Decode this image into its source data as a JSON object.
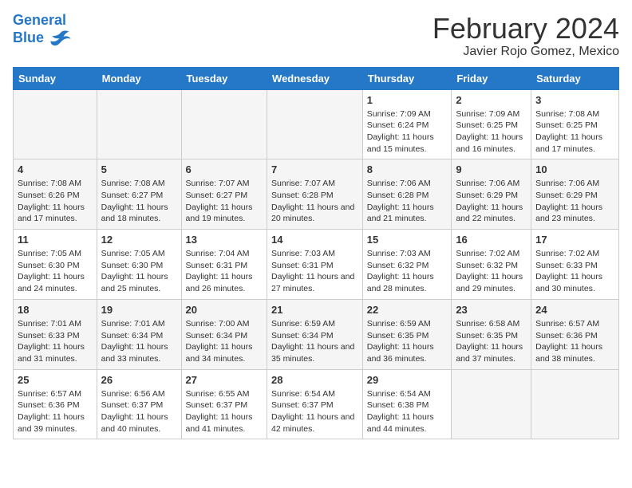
{
  "header": {
    "logo_line1": "General",
    "logo_line2": "Blue",
    "title": "February 2024",
    "subtitle": "Javier Rojo Gomez, Mexico"
  },
  "weekdays": [
    "Sunday",
    "Monday",
    "Tuesday",
    "Wednesday",
    "Thursday",
    "Friday",
    "Saturday"
  ],
  "weeks": [
    [
      {
        "day": "",
        "sunrise": "",
        "sunset": "",
        "daylight": ""
      },
      {
        "day": "",
        "sunrise": "",
        "sunset": "",
        "daylight": ""
      },
      {
        "day": "",
        "sunrise": "",
        "sunset": "",
        "daylight": ""
      },
      {
        "day": "",
        "sunrise": "",
        "sunset": "",
        "daylight": ""
      },
      {
        "day": "1",
        "sunrise": "Sunrise: 7:09 AM",
        "sunset": "Sunset: 6:24 PM",
        "daylight": "Daylight: 11 hours and 15 minutes."
      },
      {
        "day": "2",
        "sunrise": "Sunrise: 7:09 AM",
        "sunset": "Sunset: 6:25 PM",
        "daylight": "Daylight: 11 hours and 16 minutes."
      },
      {
        "day": "3",
        "sunrise": "Sunrise: 7:08 AM",
        "sunset": "Sunset: 6:25 PM",
        "daylight": "Daylight: 11 hours and 17 minutes."
      }
    ],
    [
      {
        "day": "4",
        "sunrise": "Sunrise: 7:08 AM",
        "sunset": "Sunset: 6:26 PM",
        "daylight": "Daylight: 11 hours and 17 minutes."
      },
      {
        "day": "5",
        "sunrise": "Sunrise: 7:08 AM",
        "sunset": "Sunset: 6:27 PM",
        "daylight": "Daylight: 11 hours and 18 minutes."
      },
      {
        "day": "6",
        "sunrise": "Sunrise: 7:07 AM",
        "sunset": "Sunset: 6:27 PM",
        "daylight": "Daylight: 11 hours and 19 minutes."
      },
      {
        "day": "7",
        "sunrise": "Sunrise: 7:07 AM",
        "sunset": "Sunset: 6:28 PM",
        "daylight": "Daylight: 11 hours and 20 minutes."
      },
      {
        "day": "8",
        "sunrise": "Sunrise: 7:06 AM",
        "sunset": "Sunset: 6:28 PM",
        "daylight": "Daylight: 11 hours and 21 minutes."
      },
      {
        "day": "9",
        "sunrise": "Sunrise: 7:06 AM",
        "sunset": "Sunset: 6:29 PM",
        "daylight": "Daylight: 11 hours and 22 minutes."
      },
      {
        "day": "10",
        "sunrise": "Sunrise: 7:06 AM",
        "sunset": "Sunset: 6:29 PM",
        "daylight": "Daylight: 11 hours and 23 minutes."
      }
    ],
    [
      {
        "day": "11",
        "sunrise": "Sunrise: 7:05 AM",
        "sunset": "Sunset: 6:30 PM",
        "daylight": "Daylight: 11 hours and 24 minutes."
      },
      {
        "day": "12",
        "sunrise": "Sunrise: 7:05 AM",
        "sunset": "Sunset: 6:30 PM",
        "daylight": "Daylight: 11 hours and 25 minutes."
      },
      {
        "day": "13",
        "sunrise": "Sunrise: 7:04 AM",
        "sunset": "Sunset: 6:31 PM",
        "daylight": "Daylight: 11 hours and 26 minutes."
      },
      {
        "day": "14",
        "sunrise": "Sunrise: 7:03 AM",
        "sunset": "Sunset: 6:31 PM",
        "daylight": "Daylight: 11 hours and 27 minutes."
      },
      {
        "day": "15",
        "sunrise": "Sunrise: 7:03 AM",
        "sunset": "Sunset: 6:32 PM",
        "daylight": "Daylight: 11 hours and 28 minutes."
      },
      {
        "day": "16",
        "sunrise": "Sunrise: 7:02 AM",
        "sunset": "Sunset: 6:32 PM",
        "daylight": "Daylight: 11 hours and 29 minutes."
      },
      {
        "day": "17",
        "sunrise": "Sunrise: 7:02 AM",
        "sunset": "Sunset: 6:33 PM",
        "daylight": "Daylight: 11 hours and 30 minutes."
      }
    ],
    [
      {
        "day": "18",
        "sunrise": "Sunrise: 7:01 AM",
        "sunset": "Sunset: 6:33 PM",
        "daylight": "Daylight: 11 hours and 31 minutes."
      },
      {
        "day": "19",
        "sunrise": "Sunrise: 7:01 AM",
        "sunset": "Sunset: 6:34 PM",
        "daylight": "Daylight: 11 hours and 33 minutes."
      },
      {
        "day": "20",
        "sunrise": "Sunrise: 7:00 AM",
        "sunset": "Sunset: 6:34 PM",
        "daylight": "Daylight: 11 hours and 34 minutes."
      },
      {
        "day": "21",
        "sunrise": "Sunrise: 6:59 AM",
        "sunset": "Sunset: 6:34 PM",
        "daylight": "Daylight: 11 hours and 35 minutes."
      },
      {
        "day": "22",
        "sunrise": "Sunrise: 6:59 AM",
        "sunset": "Sunset: 6:35 PM",
        "daylight": "Daylight: 11 hours and 36 minutes."
      },
      {
        "day": "23",
        "sunrise": "Sunrise: 6:58 AM",
        "sunset": "Sunset: 6:35 PM",
        "daylight": "Daylight: 11 hours and 37 minutes."
      },
      {
        "day": "24",
        "sunrise": "Sunrise: 6:57 AM",
        "sunset": "Sunset: 6:36 PM",
        "daylight": "Daylight: 11 hours and 38 minutes."
      }
    ],
    [
      {
        "day": "25",
        "sunrise": "Sunrise: 6:57 AM",
        "sunset": "Sunset: 6:36 PM",
        "daylight": "Daylight: 11 hours and 39 minutes."
      },
      {
        "day": "26",
        "sunrise": "Sunrise: 6:56 AM",
        "sunset": "Sunset: 6:37 PM",
        "daylight": "Daylight: 11 hours and 40 minutes."
      },
      {
        "day": "27",
        "sunrise": "Sunrise: 6:55 AM",
        "sunset": "Sunset: 6:37 PM",
        "daylight": "Daylight: 11 hours and 41 minutes."
      },
      {
        "day": "28",
        "sunrise": "Sunrise: 6:54 AM",
        "sunset": "Sunset: 6:37 PM",
        "daylight": "Daylight: 11 hours and 42 minutes."
      },
      {
        "day": "29",
        "sunrise": "Sunrise: 6:54 AM",
        "sunset": "Sunset: 6:38 PM",
        "daylight": "Daylight: 11 hours and 44 minutes."
      },
      {
        "day": "",
        "sunrise": "",
        "sunset": "",
        "daylight": ""
      },
      {
        "day": "",
        "sunrise": "",
        "sunset": "",
        "daylight": ""
      }
    ]
  ]
}
